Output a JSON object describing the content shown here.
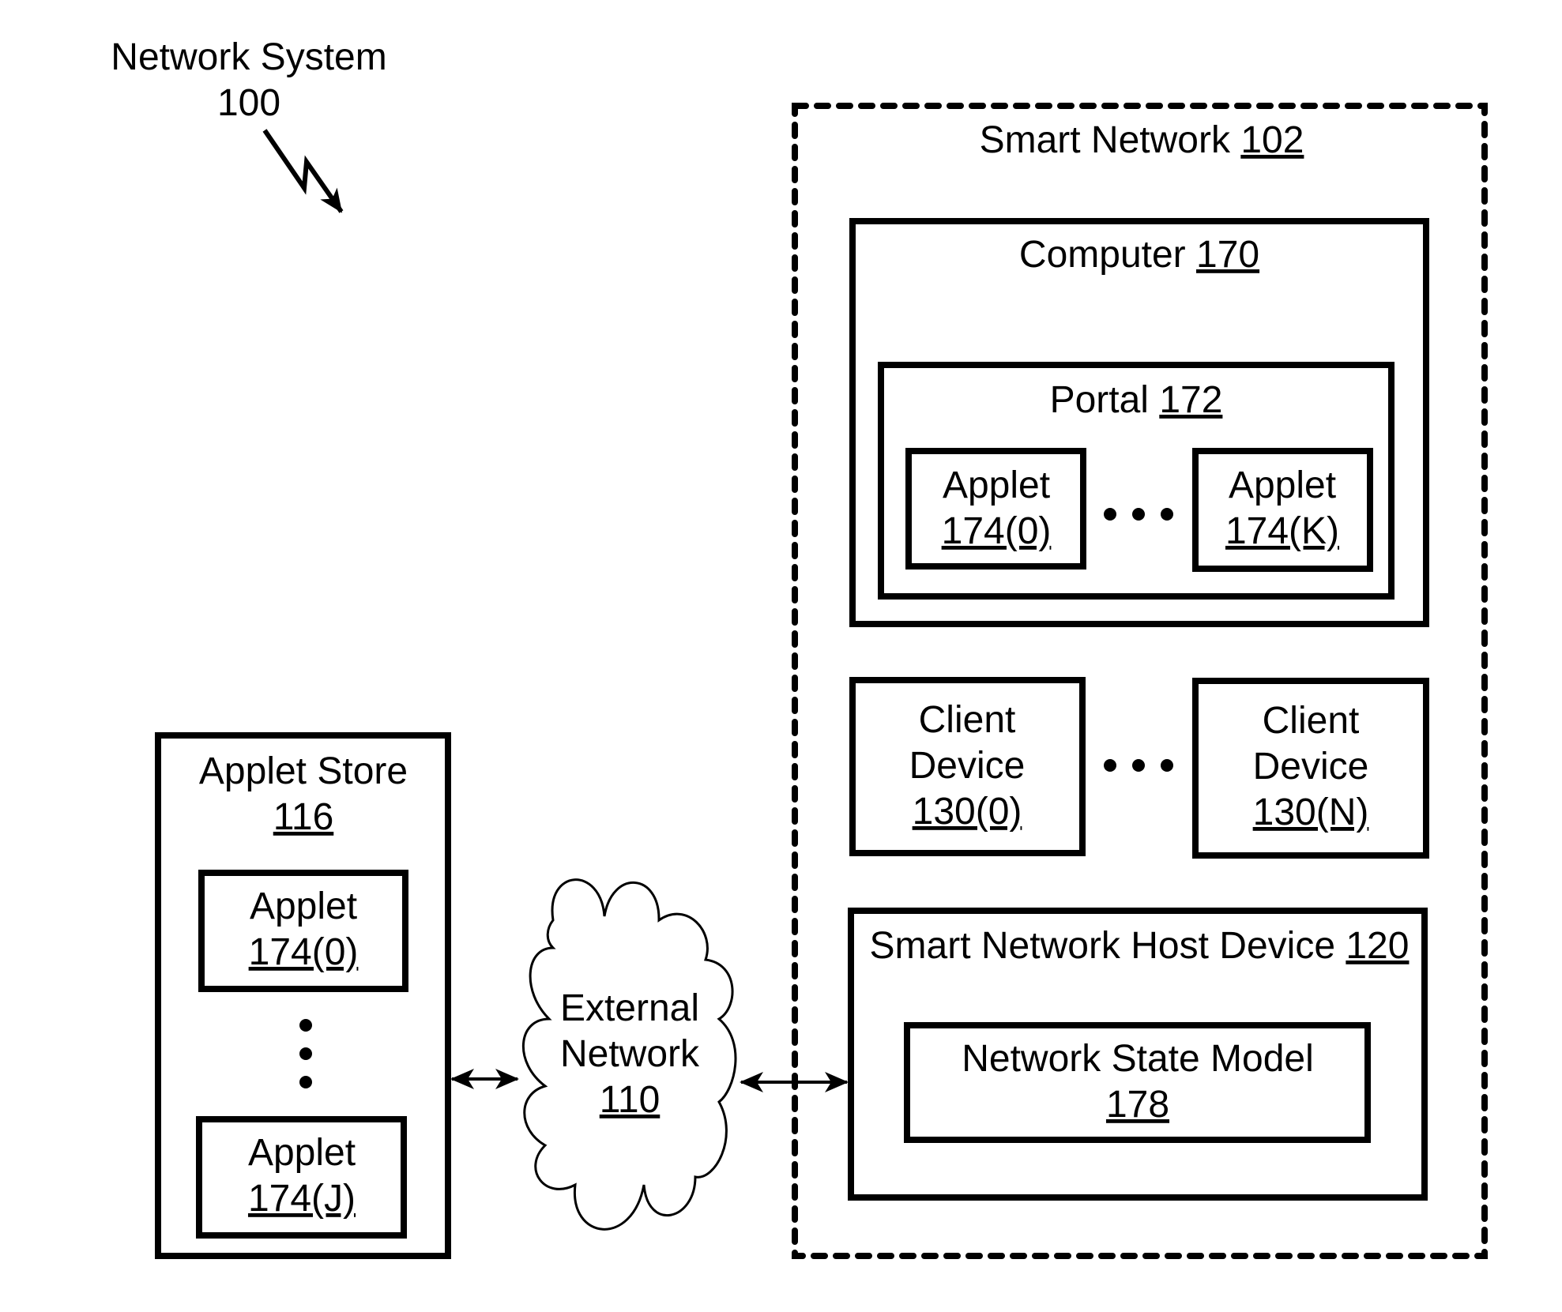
{
  "title": {
    "line1": "Network System",
    "line2": "100"
  },
  "smart_network": {
    "name": "Smart Network",
    "ref": "102"
  },
  "computer": {
    "name": "Computer",
    "ref": "170"
  },
  "portal": {
    "name": "Portal",
    "ref": "172"
  },
  "portal_applets": [
    {
      "name": "Applet",
      "ref": "174(0)"
    },
    {
      "name": "Applet",
      "ref": "174(K)"
    }
  ],
  "client_devices": [
    {
      "line1": "Client",
      "line2": "Device",
      "ref": "130(0)"
    },
    {
      "line1": "Client",
      "line2": "Device",
      "ref": "130(N)"
    }
  ],
  "host_device": {
    "name": "Smart Network Host Device",
    "ref": "120"
  },
  "network_state_model": {
    "name": "Network State Model",
    "ref": "178"
  },
  "applet_store": {
    "name": "Applet Store",
    "ref": "116"
  },
  "store_applets": [
    {
      "name": "Applet",
      "ref": "174(0)"
    },
    {
      "name": "Applet",
      "ref": "174(J)"
    }
  ],
  "external_network": {
    "line1": "External",
    "line2": "Network",
    "ref": "110"
  },
  "ellipsis": "•  •  •"
}
